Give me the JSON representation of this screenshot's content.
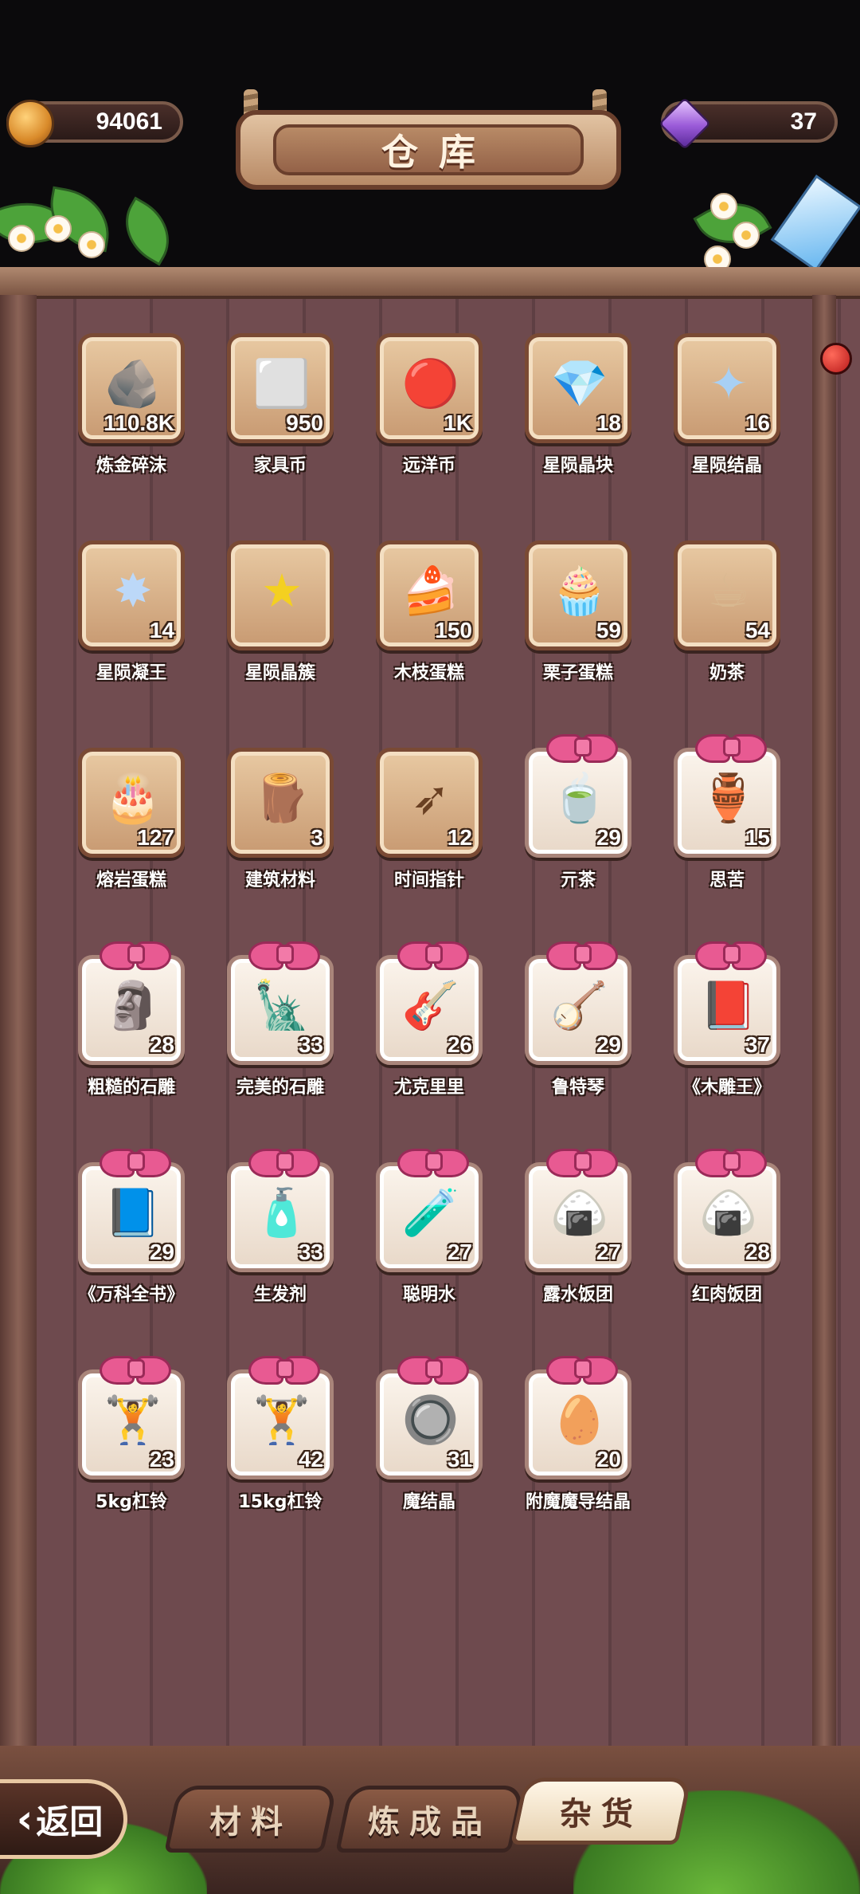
{
  "header": {
    "coin_value": "94061",
    "gem_value": "37",
    "title": "仓库"
  },
  "items": [
    {
      "name": "炼金碎沫",
      "count": "110.8K",
      "glyph": "🪨",
      "slot": "gold",
      "color": "#b08a6a"
    },
    {
      "name": "家具币",
      "count": "950",
      "glyph": "⬜",
      "slot": "gold",
      "color": "#8aa6d8"
    },
    {
      "name": "远洋币",
      "count": "1K",
      "glyph": "🔴",
      "slot": "gold",
      "color": "#e8508a"
    },
    {
      "name": "星陨晶块",
      "count": "18",
      "glyph": "💎",
      "slot": "gold",
      "color": "#a8c8f0"
    },
    {
      "name": "星陨结晶",
      "count": "16",
      "glyph": "✦",
      "slot": "gold",
      "color": "#a8d0f4"
    },
    {
      "name": "星陨凝王",
      "count": "14",
      "glyph": "✸",
      "slot": "gold",
      "color": "#bcd8f8"
    },
    {
      "name": "星陨晶簇",
      "count": "",
      "glyph": "★",
      "slot": "gold",
      "color": "#f4d020"
    },
    {
      "name": "木枝蛋糕",
      "count": "150",
      "glyph": "🍰",
      "slot": "gold",
      "color": "#7a5a3a"
    },
    {
      "name": "栗子蛋糕",
      "count": "59",
      "glyph": "🧁",
      "slot": "gold",
      "color": "#c8844a"
    },
    {
      "name": "奶茶",
      "count": "54",
      "glyph": "☕",
      "slot": "gold",
      "color": "#d8b890"
    },
    {
      "name": "熔岩蛋糕",
      "count": "127",
      "glyph": "🎂",
      "slot": "gold",
      "color": "#d83a3a"
    },
    {
      "name": "建筑材料",
      "count": "3",
      "glyph": "🪵",
      "slot": "gold",
      "color": "#8a6040"
    },
    {
      "name": "时间指针",
      "count": "12",
      "glyph": "➶",
      "slot": "gold",
      "color": "#6a4022"
    },
    {
      "name": "亓茶",
      "count": "29",
      "glyph": "🍵",
      "slot": "white",
      "color": "#7ab858"
    },
    {
      "name": "思苦",
      "count": "15",
      "glyph": "🏺",
      "slot": "white",
      "color": "#3a5aa8"
    },
    {
      "name": "粗糙的石雕",
      "count": "28",
      "glyph": "🗿",
      "slot": "white",
      "color": "#b8b8b8"
    },
    {
      "name": "完美的石雕",
      "count": "33",
      "glyph": "🗽",
      "slot": "white",
      "color": "#c8c8c8"
    },
    {
      "name": "尤克里里",
      "count": "26",
      "glyph": "🎸",
      "slot": "white",
      "color": "#a8643a"
    },
    {
      "name": "鲁特琴",
      "count": "29",
      "glyph": "🪕",
      "slot": "white",
      "color": "#c89a4a"
    },
    {
      "name": "《木雕王》",
      "count": "37",
      "glyph": "📕",
      "slot": "white",
      "color": "#8a3a2a"
    },
    {
      "name": "《万科全书》",
      "count": "29",
      "glyph": "📘",
      "slot": "white",
      "color": "#a83a5a"
    },
    {
      "name": "生发剂",
      "count": "33",
      "glyph": "🧴",
      "slot": "white",
      "color": "#f4e8a8"
    },
    {
      "name": "聪明水",
      "count": "27",
      "glyph": "🧪",
      "slot": "white",
      "color": "#f4a83a"
    },
    {
      "name": "露水饭团",
      "count": "27",
      "glyph": "🍙",
      "slot": "white",
      "color": "#3a7a3a"
    },
    {
      "name": "红肉饭团",
      "count": "28",
      "glyph": "🍙",
      "slot": "white",
      "color": "#d84a3a"
    },
    {
      "name": "5kg杠铃",
      "count": "23",
      "glyph": "🏋",
      "slot": "white",
      "color": "#3a3a3a"
    },
    {
      "name": "15kg杠铃",
      "count": "42",
      "glyph": "🏋",
      "slot": "white",
      "color": "#2a2a2a"
    },
    {
      "name": "魔结晶",
      "count": "31",
      "glyph": "🔘",
      "slot": "white",
      "color": "#8aa0b8"
    },
    {
      "name": "附魔魔导结晶",
      "count": "20",
      "glyph": "🥚",
      "slot": "white",
      "color": "#d83a2a"
    }
  ],
  "tabs": [
    {
      "label": "材料",
      "active": false
    },
    {
      "label": "炼成品",
      "active": false
    },
    {
      "label": "杂货",
      "active": true
    }
  ],
  "back_label": "返回"
}
